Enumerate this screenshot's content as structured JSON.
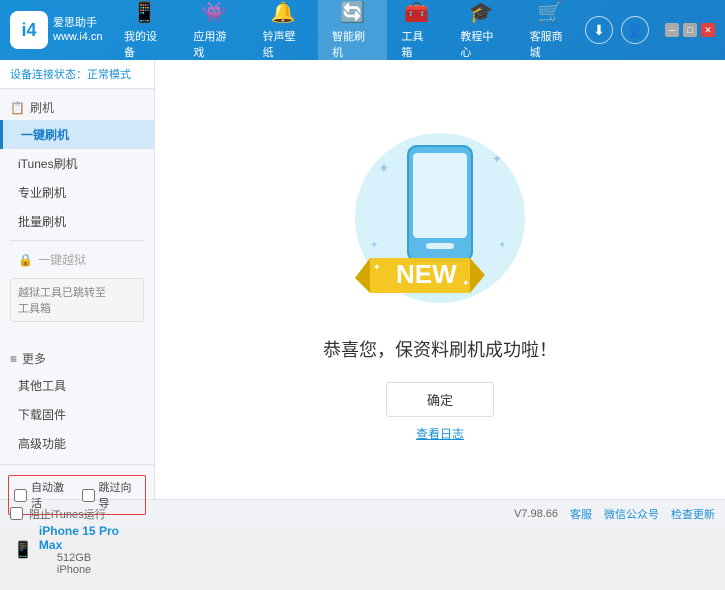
{
  "app": {
    "logo_line1": "爱思助手",
    "logo_line2": "www.i4.cn",
    "logo_letter": "i4"
  },
  "nav": {
    "items": [
      {
        "id": "my-device",
        "label": "我的设备",
        "icon": "📱"
      },
      {
        "id": "apps",
        "label": "应用游戏",
        "icon": "🎮"
      },
      {
        "id": "ringtones",
        "label": "铃声壁纸",
        "icon": "🔔"
      },
      {
        "id": "smart-flash",
        "label": "智能刷机",
        "icon": "🔄"
      },
      {
        "id": "toolbox",
        "label": "工具箱",
        "icon": "🧰"
      },
      {
        "id": "tutorial",
        "label": "教程中心",
        "icon": "🎓"
      },
      {
        "id": "service",
        "label": "客服商城",
        "icon": "💼"
      }
    ]
  },
  "status": {
    "label": "设备连接状态：",
    "value": "正常模式"
  },
  "sidebar": {
    "flash_section": "刷机",
    "items": [
      {
        "id": "one-key-flash",
        "label": "一键刷机",
        "active": true
      },
      {
        "id": "itunes-flash",
        "label": "iTunes刷机",
        "active": false
      },
      {
        "id": "pro-flash",
        "label": "专业刷机",
        "active": false
      },
      {
        "id": "batch-flash",
        "label": "批量刷机",
        "active": false
      }
    ],
    "one_key_recovery": "一键越狱",
    "warning_line1": "越狱工具已跳转至",
    "warning_line2": "工具箱",
    "more_section": "更多",
    "more_items": [
      {
        "id": "other-tools",
        "label": "其他工具"
      },
      {
        "id": "download-firmware",
        "label": "下载固件"
      },
      {
        "id": "advanced",
        "label": "高级功能"
      }
    ]
  },
  "auto_controls": {
    "auto_activate": "自动激活",
    "skip_guide": "跳过向导"
  },
  "device": {
    "icon": "📱",
    "name": "iPhone 15 Pro Max",
    "storage": "512GB",
    "type": "iPhone"
  },
  "bottom": {
    "itunes_label": "阻止iTunes运行",
    "version": "V7.98.66",
    "links": [
      "客服",
      "微信公众号",
      "检查更新"
    ]
  },
  "content": {
    "success_text": "恭喜您，保资料刷机成功啦！",
    "confirm_btn": "确定",
    "log_link": "查看日志",
    "new_badge": "NEW"
  }
}
